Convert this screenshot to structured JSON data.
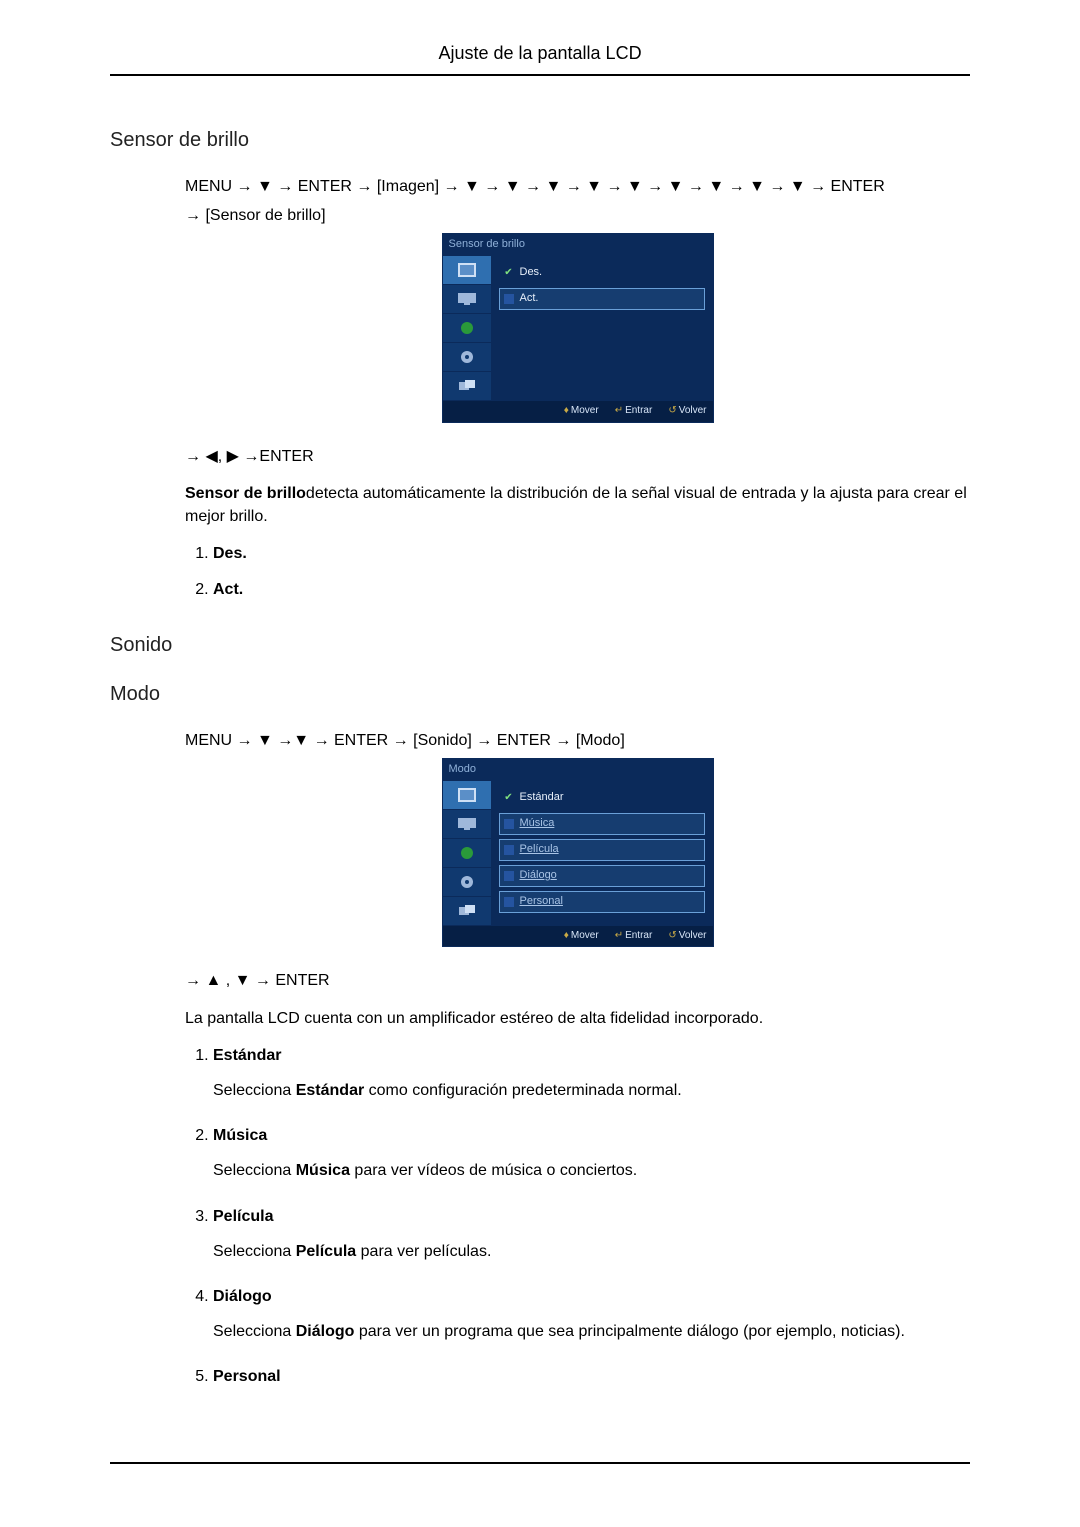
{
  "header": {
    "title": "Ajuste de la pantalla LCD"
  },
  "section1": {
    "heading": "Sensor de brillo",
    "path_prefix": "MENU → ▼ → ENTER → [Imagen] → ▼ → ▼ → ▼ → ▼ → ▼ → ▼ → ▼ → ▼ → ▼ → ENTER",
    "path_suffix": "→ [Sensor de brillo]",
    "osd": {
      "title": "Sensor de brillo",
      "items": [
        {
          "label": "Des.",
          "selected": true,
          "checked": true
        },
        {
          "label": "Act.",
          "selected": false,
          "checked": false
        }
      ],
      "footer": {
        "mover": "Mover",
        "entrar": "Entrar",
        "volver": "Volver"
      }
    },
    "nav_hint": "→ ◀, ▶ →ENTER",
    "desc_bold": "Sensor de brillo",
    "desc_rest": "detecta automáticamente la distribución de la señal visual de entrada y la ajusta para crear el mejor brillo.",
    "options": [
      {
        "label": "Des."
      },
      {
        "label": "Act."
      }
    ]
  },
  "section2": {
    "heading": "Sonido",
    "sub_heading": "Modo",
    "path": "MENU → ▼ →▼ → ENTER → [Sonido] → ENTER → [Modo]",
    "osd": {
      "title": "Modo",
      "items": [
        {
          "label": "Estándar",
          "selected": true,
          "checked": true
        },
        {
          "label": "Música"
        },
        {
          "label": "Película"
        },
        {
          "label": "Diálogo"
        },
        {
          "label": "Personal"
        }
      ],
      "footer": {
        "mover": "Mover",
        "entrar": "Entrar",
        "volver": "Volver"
      }
    },
    "nav_hint": "→ ▲ , ▼ → ENTER",
    "intro": "La pantalla LCD cuenta con un amplificador estéreo de alta fidelidad incorporado.",
    "options": [
      {
        "title": "Estándar",
        "desc_pre": "Selecciona ",
        "desc_bold": "Estándar",
        "desc_post": " como configuración predeterminada normal."
      },
      {
        "title": "Música",
        "desc_pre": "Selecciona ",
        "desc_bold": "Música",
        "desc_post": " para ver vídeos de música o conciertos."
      },
      {
        "title": "Película",
        "desc_pre": "Selecciona ",
        "desc_bold": "Película",
        "desc_post": " para ver películas."
      },
      {
        "title": "Diálogo",
        "desc_pre": "Selecciona ",
        "desc_bold": "Diálogo",
        "desc_post": " para ver un programa que sea principalmente diálogo (por ejemplo, noticias)."
      },
      {
        "title": "Personal"
      }
    ]
  }
}
